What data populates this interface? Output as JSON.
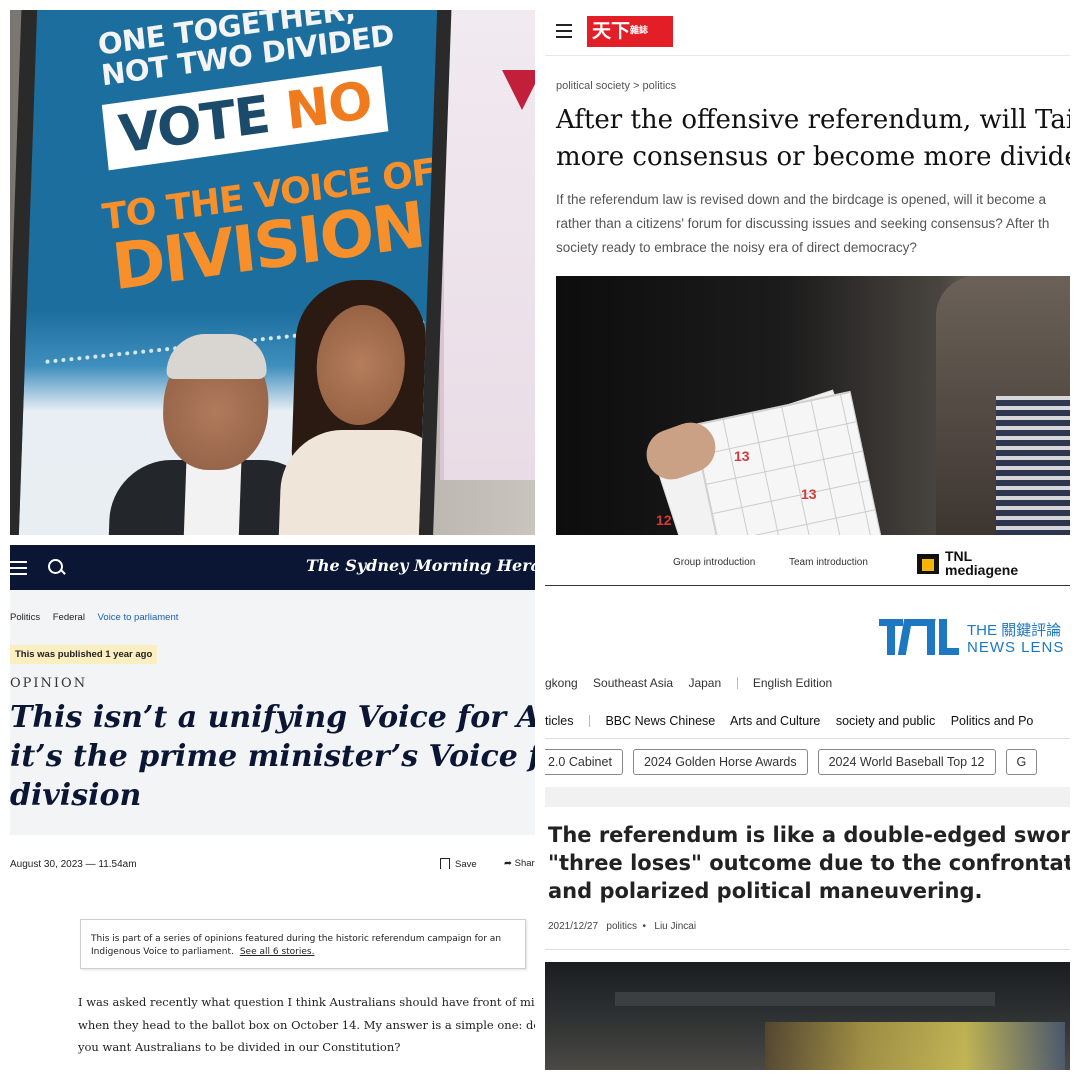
{
  "poster": {
    "line1": "ONE TOGETHER,",
    "line2": "NOT TWO DIVIDED",
    "vote": "VOTE",
    "no": "NO",
    "line3": "TO THE VOICE OF",
    "line4": "DIVISION"
  },
  "commonwealth": {
    "breadcrumb": "political society > politics",
    "headline_line1": "After the offensive referendum, will Taiw",
    "headline_line2": "more consensus or become more dividec",
    "lede_line1": "If the referendum law is revised down and the birdcage is opened, will it become a",
    "lede_line2": "rather than a citizens' forum for discussing issues and seeking consensus? After th",
    "lede_line3": "society ready to embrace the noisy era of direct democracy?",
    "photo_numbers": [
      "13",
      "13",
      "12"
    ]
  },
  "smh": {
    "masthead": "The Sydney Morning Herald",
    "crumbs": [
      "Politics",
      "Federal",
      "Voice to parliament"
    ],
    "published_badge": "This was published 1 year ago",
    "kicker": "OPINION",
    "headline_line1": "This isn’t a unifying Voice for Austral",
    "headline_line2": "it’s the prime minister’s Voice for",
    "headline_line3": "division",
    "dateline": "August 30, 2023 — 11.54am",
    "save_label": "Save",
    "share_label": "Shar",
    "note_text": "This is part of a series of opinions featured during the historic referendum campaign for an Indigenous Voice to parliament.",
    "note_link": "See all 6 stories.",
    "body_line1": "I was asked recently what question I think Australians should have front of mind",
    "body_line2": "when they head to the ballot box on October 14. My answer is a simple one: do",
    "body_line3": "you want Australians to be divided in our Constitution?"
  },
  "newslens": {
    "top_links": [
      "Group introduction",
      "Team introduction"
    ],
    "mediagene_line1": "TNL",
    "mediagene_line2": "mediagene",
    "brand_top": "THE 關鍵評論",
    "brand_bottom": "NEWS LENS",
    "regions": [
      "gkong",
      "Southeast Asia",
      "Japan"
    ],
    "edition": "English Edition",
    "categories_first": "ticles",
    "categories": [
      "BBC News Chinese",
      "Arts and Culture",
      "society and public",
      "Politics and Po"
    ],
    "tags": [
      "2.0 Cabinet",
      "2024 Golden Horse Awards",
      "2024 World Baseball Top 12",
      "G"
    ],
    "headline_line1": "The referendum is like a double-edged sword",
    "headline_line2": "\"three loses\" outcome due to the confrontatic",
    "headline_line3": "and polarized political maneuvering.",
    "date": "2021/12/27",
    "category": "politics",
    "author": "Liu Jincai"
  },
  "colors": {
    "smh_navy": "#0a1633",
    "cw_red": "#e41e26",
    "tnl_blue": "#1d78c1",
    "poster_blue": "#1c6e9e",
    "poster_orange": "#f7902a"
  }
}
